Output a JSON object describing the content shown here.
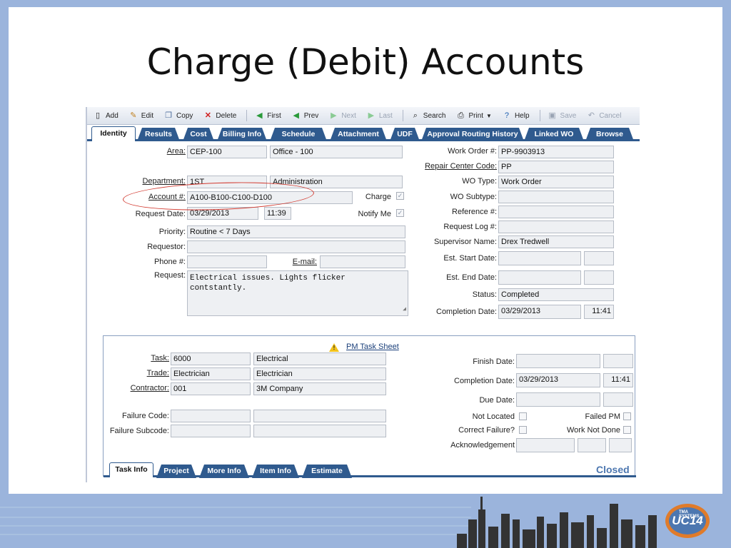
{
  "slide": {
    "title": "Charge (Debit) Accounts"
  },
  "toolbar": {
    "buttons": [
      "Add",
      "Edit",
      "Copy",
      "Delete",
      "First",
      "Prev",
      "Next",
      "Last",
      "Search",
      "Print",
      "Help",
      "Save",
      "Cancel"
    ]
  },
  "tabs": [
    "Identity",
    "Results",
    "Cost",
    "Billing Info",
    "Schedule",
    "Attachment",
    "UDF",
    "Approval Routing History",
    "Linked WO",
    "Browse"
  ],
  "identity": {
    "area_label": "Area:",
    "area_code": "CEP-100",
    "area_name": "Office - 100",
    "department_label": "Department:",
    "department_code": "1ST",
    "department_name": "Administration",
    "account_label": "Account #:",
    "account_value": "A100-B100-C100-D100",
    "charge_label": "Charge",
    "charge_checked": true,
    "request_date_label": "Request Date:",
    "request_date": "03/29/2013",
    "request_time": "11:39",
    "notify_label": "Notify Me",
    "notify_checked": true,
    "priority_label": "Priority:",
    "priority": "Routine < 7 Days",
    "requestor_label": "Requestor:",
    "requestor": "",
    "phone_label": "Phone #:",
    "phone": "",
    "email_label": "E-mail:",
    "email": "",
    "request_label": "Request:",
    "request_text": "Electrical issues. Lights flicker\ncontstantly."
  },
  "workorder": {
    "wo_num_label": "Work Order #:",
    "wo_num": "PP-9903913",
    "repair_center_label": "Repair Center Code:",
    "repair_center": "PP",
    "wo_type_label": "WO Type:",
    "wo_type": "Work Order",
    "wo_subtype_label": "WO Subtype:",
    "wo_subtype": "",
    "reference_label": "Reference #:",
    "reference": "",
    "request_log_label": "Request Log #:",
    "request_log": "",
    "supervisor_label": "Supervisor Name:",
    "supervisor": "Drex Tredwell",
    "est_start_label": "Est. Start Date:",
    "est_start": "",
    "est_end_label": "Est. End Date:",
    "est_end": "",
    "status_label": "Status:",
    "status": "Completed",
    "completion_label": "Completion Date:",
    "completion_date": "03/29/2013",
    "completion_time": "11:41"
  },
  "pm": {
    "sheet_link": "PM Task Sheet",
    "task_label": "Task:",
    "task_code": "6000",
    "task_name": "Electrical",
    "trade_label": "Trade:",
    "trade_code": "Electrician",
    "trade_name": "Electrician",
    "contractor_label": "Contractor:",
    "contractor_code": "001",
    "contractor_name": "3M Company",
    "failure_code_label": "Failure Code:",
    "failure_subcode_label": "Failure Subcode:",
    "finish_label": "Finish Date:",
    "finish_date": "",
    "completion_label": "Completion Date:",
    "completion_date": "03/29/2013",
    "completion_time": "11:41",
    "due_label": "Due Date:",
    "due_date": "",
    "not_located_label": "Not Located",
    "failed_pm_label": "Failed PM",
    "correct_failure_label": "Correct Failure?",
    "work_not_done_label": "Work Not Done",
    "acknowledgement_label": "Acknowledgement",
    "status_text": "Closed",
    "bottom_tabs": [
      "Task Info",
      "Project",
      "More Info",
      "Item Info",
      "Estimate"
    ]
  },
  "footer": {
    "logo_text": "UC14",
    "logo_small": "TMA SYSTEMS"
  },
  "colors": {
    "tab_blue": "#2f5a8e",
    "annotation_red": "#d23a30",
    "slide_border": "#9bb4dc"
  }
}
